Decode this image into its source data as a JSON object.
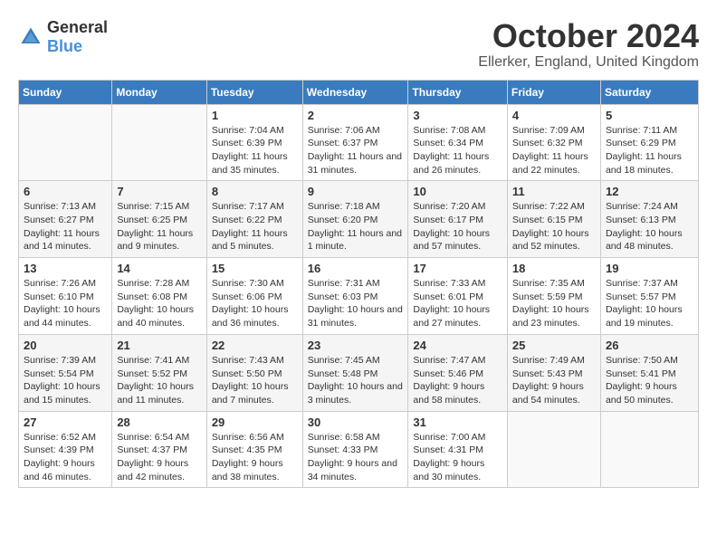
{
  "header": {
    "logo": {
      "general": "General",
      "blue": "Blue"
    },
    "title": "October 2024",
    "location": "Ellerker, England, United Kingdom"
  },
  "weekdays": [
    "Sunday",
    "Monday",
    "Tuesday",
    "Wednesday",
    "Thursday",
    "Friday",
    "Saturday"
  ],
  "weeks": [
    [
      null,
      null,
      {
        "day": 1,
        "sunrise": "7:04 AM",
        "sunset": "6:39 PM",
        "daylight": "11 hours and 35 minutes."
      },
      {
        "day": 2,
        "sunrise": "7:06 AM",
        "sunset": "6:37 PM",
        "daylight": "11 hours and 31 minutes."
      },
      {
        "day": 3,
        "sunrise": "7:08 AM",
        "sunset": "6:34 PM",
        "daylight": "11 hours and 26 minutes."
      },
      {
        "day": 4,
        "sunrise": "7:09 AM",
        "sunset": "6:32 PM",
        "daylight": "11 hours and 22 minutes."
      },
      {
        "day": 5,
        "sunrise": "7:11 AM",
        "sunset": "6:29 PM",
        "daylight": "11 hours and 18 minutes."
      }
    ],
    [
      {
        "day": 6,
        "sunrise": "7:13 AM",
        "sunset": "6:27 PM",
        "daylight": "11 hours and 14 minutes."
      },
      {
        "day": 7,
        "sunrise": "7:15 AM",
        "sunset": "6:25 PM",
        "daylight": "11 hours and 9 minutes."
      },
      {
        "day": 8,
        "sunrise": "7:17 AM",
        "sunset": "6:22 PM",
        "daylight": "11 hours and 5 minutes."
      },
      {
        "day": 9,
        "sunrise": "7:18 AM",
        "sunset": "6:20 PM",
        "daylight": "11 hours and 1 minute."
      },
      {
        "day": 10,
        "sunrise": "7:20 AM",
        "sunset": "6:17 PM",
        "daylight": "10 hours and 57 minutes."
      },
      {
        "day": 11,
        "sunrise": "7:22 AM",
        "sunset": "6:15 PM",
        "daylight": "10 hours and 52 minutes."
      },
      {
        "day": 12,
        "sunrise": "7:24 AM",
        "sunset": "6:13 PM",
        "daylight": "10 hours and 48 minutes."
      }
    ],
    [
      {
        "day": 13,
        "sunrise": "7:26 AM",
        "sunset": "6:10 PM",
        "daylight": "10 hours and 44 minutes."
      },
      {
        "day": 14,
        "sunrise": "7:28 AM",
        "sunset": "6:08 PM",
        "daylight": "10 hours and 40 minutes."
      },
      {
        "day": 15,
        "sunrise": "7:30 AM",
        "sunset": "6:06 PM",
        "daylight": "10 hours and 36 minutes."
      },
      {
        "day": 16,
        "sunrise": "7:31 AM",
        "sunset": "6:03 PM",
        "daylight": "10 hours and 31 minutes."
      },
      {
        "day": 17,
        "sunrise": "7:33 AM",
        "sunset": "6:01 PM",
        "daylight": "10 hours and 27 minutes."
      },
      {
        "day": 18,
        "sunrise": "7:35 AM",
        "sunset": "5:59 PM",
        "daylight": "10 hours and 23 minutes."
      },
      {
        "day": 19,
        "sunrise": "7:37 AM",
        "sunset": "5:57 PM",
        "daylight": "10 hours and 19 minutes."
      }
    ],
    [
      {
        "day": 20,
        "sunrise": "7:39 AM",
        "sunset": "5:54 PM",
        "daylight": "10 hours and 15 minutes."
      },
      {
        "day": 21,
        "sunrise": "7:41 AM",
        "sunset": "5:52 PM",
        "daylight": "10 hours and 11 minutes."
      },
      {
        "day": 22,
        "sunrise": "7:43 AM",
        "sunset": "5:50 PM",
        "daylight": "10 hours and 7 minutes."
      },
      {
        "day": 23,
        "sunrise": "7:45 AM",
        "sunset": "5:48 PM",
        "daylight": "10 hours and 3 minutes."
      },
      {
        "day": 24,
        "sunrise": "7:47 AM",
        "sunset": "5:46 PM",
        "daylight": "9 hours and 58 minutes."
      },
      {
        "day": 25,
        "sunrise": "7:49 AM",
        "sunset": "5:43 PM",
        "daylight": "9 hours and 54 minutes."
      },
      {
        "day": 26,
        "sunrise": "7:50 AM",
        "sunset": "5:41 PM",
        "daylight": "9 hours and 50 minutes."
      }
    ],
    [
      {
        "day": 27,
        "sunrise": "6:52 AM",
        "sunset": "4:39 PM",
        "daylight": "9 hours and 46 minutes."
      },
      {
        "day": 28,
        "sunrise": "6:54 AM",
        "sunset": "4:37 PM",
        "daylight": "9 hours and 42 minutes."
      },
      {
        "day": 29,
        "sunrise": "6:56 AM",
        "sunset": "4:35 PM",
        "daylight": "9 hours and 38 minutes."
      },
      {
        "day": 30,
        "sunrise": "6:58 AM",
        "sunset": "4:33 PM",
        "daylight": "9 hours and 34 minutes."
      },
      {
        "day": 31,
        "sunrise": "7:00 AM",
        "sunset": "4:31 PM",
        "daylight": "9 hours and 30 minutes."
      },
      null,
      null
    ]
  ]
}
